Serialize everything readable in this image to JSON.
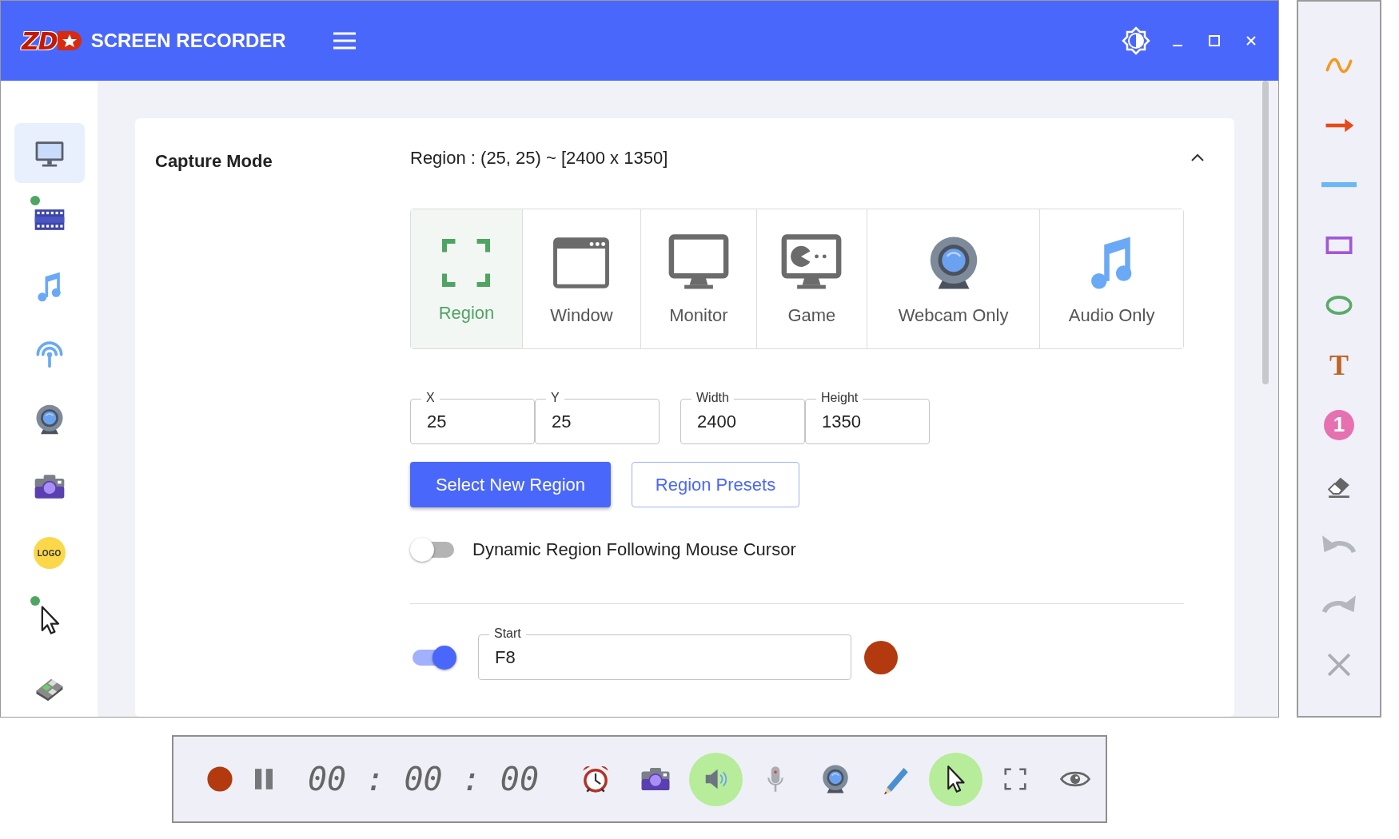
{
  "app": {
    "logo_text": "ZD",
    "title": "SCREEN RECORDER"
  },
  "sidebar": {
    "items": [
      {
        "kind": "monitor",
        "selected": true,
        "indicator": false
      },
      {
        "kind": "film",
        "selected": false,
        "indicator": true
      },
      {
        "kind": "music",
        "selected": false,
        "indicator": false
      },
      {
        "kind": "broadcast",
        "selected": false,
        "indicator": false
      },
      {
        "kind": "webcam",
        "selected": false,
        "indicator": false
      },
      {
        "kind": "camera",
        "selected": false,
        "indicator": false
      },
      {
        "kind": "logo",
        "label": "LOGO",
        "selected": false,
        "indicator": false
      },
      {
        "kind": "cursor",
        "selected": false,
        "indicator": true
      },
      {
        "kind": "keyboard",
        "selected": false,
        "indicator": false
      }
    ]
  },
  "capture": {
    "title": "Capture Mode",
    "summary": "Region : (25, 25) ~ [2400 x 1350]",
    "expanded": true,
    "modes": [
      {
        "kind": "region",
        "label": "Region",
        "selected": true
      },
      {
        "kind": "window",
        "label": "Window",
        "selected": false
      },
      {
        "kind": "monitor",
        "label": "Monitor",
        "selected": false
      },
      {
        "kind": "game",
        "label": "Game",
        "selected": false
      },
      {
        "kind": "webcam",
        "label": "Webcam Only",
        "selected": false
      },
      {
        "kind": "audio",
        "label": "Audio Only",
        "selected": false
      }
    ],
    "fields": [
      {
        "label": "X",
        "value": "25"
      },
      {
        "label": "Y",
        "value": "25"
      },
      {
        "label": "Width",
        "value": "2400"
      },
      {
        "label": "Height",
        "value": "1350"
      }
    ],
    "buttons": [
      {
        "kind": "primary",
        "label": "Select New Region"
      },
      {
        "kind": "outline",
        "label": "Region Presets"
      }
    ],
    "dynamic_region": {
      "label": "Dynamic Region Following Mouse Cursor",
      "on": false
    },
    "hotkey": {
      "on": true,
      "label": "Start",
      "value": "F8"
    }
  },
  "draw_tools": [
    {
      "kind": "curve"
    },
    {
      "kind": "arrow"
    },
    {
      "kind": "line"
    },
    {
      "kind": "rect"
    },
    {
      "kind": "ellipse"
    },
    {
      "kind": "text",
      "glyph": "T"
    },
    {
      "kind": "step",
      "glyph": "1"
    },
    {
      "kind": "eraser"
    },
    {
      "kind": "undo"
    },
    {
      "kind": "redo"
    },
    {
      "kind": "close"
    }
  ],
  "record_bar": {
    "controls": [
      {
        "kind": "record"
      },
      {
        "kind": "pause"
      }
    ],
    "timer": "00 : 00 : 00",
    "tools": [
      {
        "kind": "alarm",
        "on": false
      },
      {
        "kind": "camera",
        "on": false
      },
      {
        "kind": "speaker",
        "on": true
      },
      {
        "kind": "mic",
        "on": false
      },
      {
        "kind": "webcam",
        "on": false
      },
      {
        "kind": "pen",
        "on": false
      },
      {
        "kind": "cursor",
        "on": true
      },
      {
        "kind": "fullscreen",
        "on": false
      },
      {
        "kind": "eye",
        "on": false
      }
    ]
  }
}
